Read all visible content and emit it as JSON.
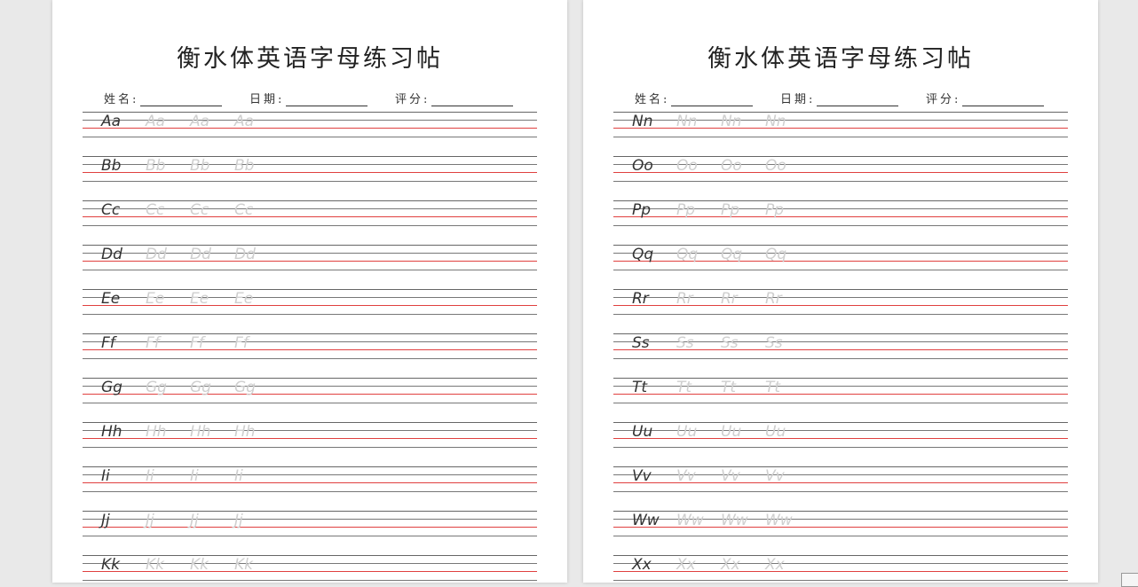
{
  "pages": [
    {
      "title": "衡水体英语字母练习帖",
      "fields": {
        "name_label": "姓名:",
        "date_label": "日期:",
        "score_label": "评分:"
      },
      "letters": [
        "Aa",
        "Bb",
        "Cc",
        "Dd",
        "Ee",
        "Ff",
        "Gg",
        "Hh",
        "Ii",
        "Jj",
        "Kk"
      ]
    },
    {
      "title": "衡水体英语字母练习帖",
      "fields": {
        "name_label": "姓名:",
        "date_label": "日期:",
        "score_label": "评分:"
      },
      "letters": [
        "Nn",
        "Oo",
        "Pp",
        "Qq",
        "Rr",
        "Ss",
        "Tt",
        "Uu",
        "Vv",
        "Ww",
        "Xx"
      ]
    }
  ],
  "colors": {
    "guide_red": "#e0403f",
    "guide_gray": "#777777",
    "trace_gray": "#cfcfcf",
    "ink": "#333333"
  }
}
